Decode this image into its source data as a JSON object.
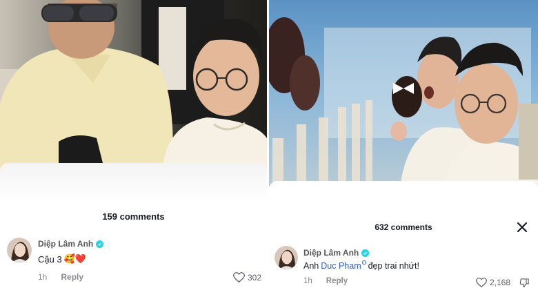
{
  "left": {
    "comments_count": "159 comments",
    "comment": {
      "author": "Diệp Lâm Anh",
      "text": "Cậu 3",
      "emoji": "🥰❤️",
      "time": "1h",
      "reply_label": "Reply",
      "likes": "302"
    }
  },
  "right": {
    "comments_count": "632 comments",
    "comment": {
      "author": "Diệp Lâm Anh",
      "text_before": "Anh",
      "mention": "Duc Pham",
      "text_after": "đẹp trai nhứt!",
      "time": "1h",
      "reply_label": "Reply",
      "likes": "2,168"
    }
  },
  "colors": {
    "verified_badge": "#20d5ec",
    "mention": "#2b5db9",
    "meta_gray": "#8a8b91"
  },
  "icons": [
    "verified-icon",
    "heart-outline-icon",
    "dislike-icon",
    "close-icon",
    "search-mini-icon"
  ]
}
